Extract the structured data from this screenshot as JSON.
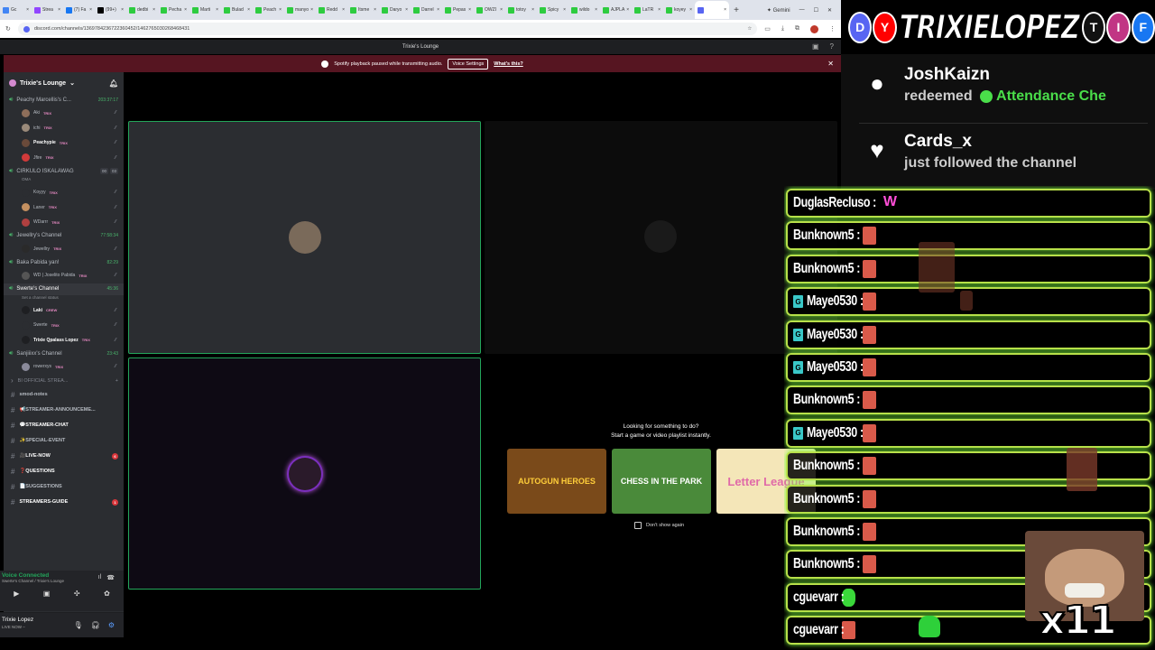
{
  "browser": {
    "tabs": [
      {
        "label": "Gc",
        "color": "#4285f4"
      },
      {
        "label": "Strea",
        "color": "#9146ff"
      },
      {
        "label": "(7) Fa",
        "color": "#1877f2"
      },
      {
        "label": "(99+)",
        "color": "#000000"
      },
      {
        "label": "dedbi",
        "color": "#2ecc40"
      },
      {
        "label": "Pecha",
        "color": "#2ecc40"
      },
      {
        "label": "Marti",
        "color": "#2ecc40"
      },
      {
        "label": "Bulad",
        "color": "#2ecc40"
      },
      {
        "label": "Peach",
        "color": "#2ecc40"
      },
      {
        "label": "manyo",
        "color": "#2ecc40"
      },
      {
        "label": "Redd",
        "color": "#2ecc40"
      },
      {
        "label": "Itsme",
        "color": "#2ecc40"
      },
      {
        "label": "Daryo",
        "color": "#2ecc40"
      },
      {
        "label": "Darrel",
        "color": "#2ecc40"
      },
      {
        "label": "Pepas",
        "color": "#2ecc40"
      },
      {
        "label": "OWZI",
        "color": "#2ecc40"
      },
      {
        "label": "totoy",
        "color": "#2ecc40"
      },
      {
        "label": "Spicy",
        "color": "#2ecc40"
      },
      {
        "label": "wildo",
        "color": "#2ecc40"
      },
      {
        "label": "AJPLA",
        "color": "#2ecc40"
      },
      {
        "label": "LaTR",
        "color": "#2ecc40"
      },
      {
        "label": "koyey",
        "color": "#2ecc40"
      },
      {
        "label": "",
        "color": "#5865f2",
        "active": true
      }
    ],
    "new_tab": "+",
    "gemini": "Gemini",
    "url": "discord.com/channels/1369784236722360452/1462765030268468431"
  },
  "discord": {
    "window_title": "Trixie's Lounge",
    "notice": {
      "text": "Spotify playback paused while transmitting audio.",
      "button": "Voice Settings",
      "link": "What's this?"
    },
    "server_name": "Trixie's Lounge",
    "voice_channels": [
      {
        "name": "Peachy Marcellis's C...",
        "timer": "203:37:17",
        "users": [
          {
            "name": "Aki",
            "tag": "TRIX",
            "color": "#8e6e5a"
          },
          {
            "name": "ichi",
            "tag": "TRIX",
            "color": "#9a8a7a"
          },
          {
            "name": "Peachypie",
            "tag": "TRIX",
            "color": "#6a4a3a",
            "bold": true
          },
          {
            "name": "Jfire",
            "tag": "TRIX",
            "color": "#d13a3a"
          }
        ]
      },
      {
        "name": "CIRKULO ISKALAWAG",
        "badges": [
          "00",
          "03"
        ],
        "status": "OMA",
        "users": [
          {
            "name": "Koyyy",
            "tag": "TRIX",
            "color": "#2b2d31"
          },
          {
            "name": "Laner",
            "tag": "TRIX",
            "color": "#c49060"
          },
          {
            "name": "WDarrr",
            "tag": "TRIX",
            "color": "#b04040"
          }
        ]
      },
      {
        "name": "Jewellry's Channel",
        "timer": "77:58:34",
        "users": [
          {
            "name": "Jewellry",
            "tag": "TRIX",
            "color": "#2a2a2a"
          }
        ]
      },
      {
        "name": "Baka Pabida yan!",
        "timer": "82:29",
        "users": [
          {
            "name": "WD | Joselito Pabida",
            "tag": "TRIX",
            "color": "#555"
          }
        ]
      },
      {
        "name": "Swerte's Channel",
        "timer": "45:36",
        "status": "Set a channel status",
        "selected": true,
        "users": [
          {
            "name": "Laki",
            "tag": "CREW",
            "color": "#1e1f22",
            "bold": true
          },
          {
            "name": "Swerte",
            "tag": "TRIX",
            "color": "#2b2d31"
          },
          {
            "name": "Trixie Qpalass Lopez",
            "tag": "TRIX",
            "color": "#1e1f22",
            "bold": true
          }
        ]
      },
      {
        "name": "Sanjiiixx's Channel",
        "timer": "23:43",
        "users": [
          {
            "name": "rowerxys",
            "tag": "TRIX",
            "color": "#8a8a9a"
          }
        ]
      }
    ],
    "text_channels": [
      {
        "name": "BI OFFICIAL STREA...",
        "category": true
      },
      {
        "name": "smod-notes"
      },
      {
        "name": "📢STREAMER-ANNOUNCEME..."
      },
      {
        "name": "💬STREAMER-CHAT",
        "bold": true
      },
      {
        "name": "✨SPECIAL-EVENT"
      },
      {
        "name": "🎥LIVE-NOW",
        "bold": true,
        "badge": "6"
      },
      {
        "name": "❓QUESTIONS",
        "bold": true
      },
      {
        "name": "📄SUGGESTIONS"
      },
      {
        "name": "STREAMERS-GUIDE",
        "bold": true,
        "badge": "1"
      }
    ],
    "voice_panel": {
      "title": "Voice Connected",
      "sub": "Swerte's Channel / Trixie's Lounge"
    },
    "user_panel": {
      "name": "Trixie Lopez",
      "status": "LIVE NOW –"
    },
    "activity": {
      "heading1": "Looking for something to do?",
      "heading2": "Start a game or video playlist instantly.",
      "cards": [
        {
          "title": "AUTOGUN HEROES",
          "bg": "#7a4a1a",
          "fg": "#ffce3a"
        },
        {
          "title": "CHESS IN THE PARK",
          "bg": "#4a8a3a",
          "fg": "#ffffff"
        },
        {
          "title": "Letter League",
          "bg": "#f4e6b8",
          "fg": "#e06aa8"
        }
      ],
      "checkbox": "Don't show again"
    }
  },
  "overlay": {
    "brand": "TRIXIELOPEZ",
    "socials": [
      {
        "name": "discord",
        "color": "#5865f2"
      },
      {
        "name": "youtube",
        "color": "#ff0000"
      }
    ],
    "socials_after": [
      {
        "name": "tiktok",
        "color": "#111111"
      },
      {
        "name": "instagram",
        "color": "#c13584"
      },
      {
        "name": "facebook",
        "color": "#1877f2"
      }
    ],
    "alerts": [
      {
        "user": "JoshKaizn",
        "action": "redeemed",
        "reward": "Attendance Che"
      },
      {
        "user": "Cards_x",
        "action": "just followed the channel"
      }
    ],
    "chat": [
      {
        "name": "DuglasRecluso :",
        "emote": "w"
      },
      {
        "name": "Bunknown5 :",
        "emote": "r"
      },
      {
        "name": "Bunknown5 :",
        "emote": "r"
      },
      {
        "name": "Maye0530 :",
        "emote": "r",
        "badge": true
      },
      {
        "name": "Maye0530 :",
        "emote": "r",
        "badge": true
      },
      {
        "name": "Maye0530 :",
        "emote": "r",
        "badge": true
      },
      {
        "name": "Bunknown5 :",
        "emote": "r"
      },
      {
        "name": "Maye0530 :",
        "emote": "r",
        "badge": true
      },
      {
        "name": "Bunknown5 :",
        "emote": "r"
      },
      {
        "name": "Bunknown5 :",
        "emote": "r"
      },
      {
        "name": "Bunknown5 :",
        "emote": "r"
      },
      {
        "name": "Bunknown5 :",
        "emote": "r"
      },
      {
        "name": "cguevarr :",
        "emote": "g"
      },
      {
        "name": "cguevarr :",
        "emote": "r"
      }
    ],
    "multiplier": "x11"
  }
}
